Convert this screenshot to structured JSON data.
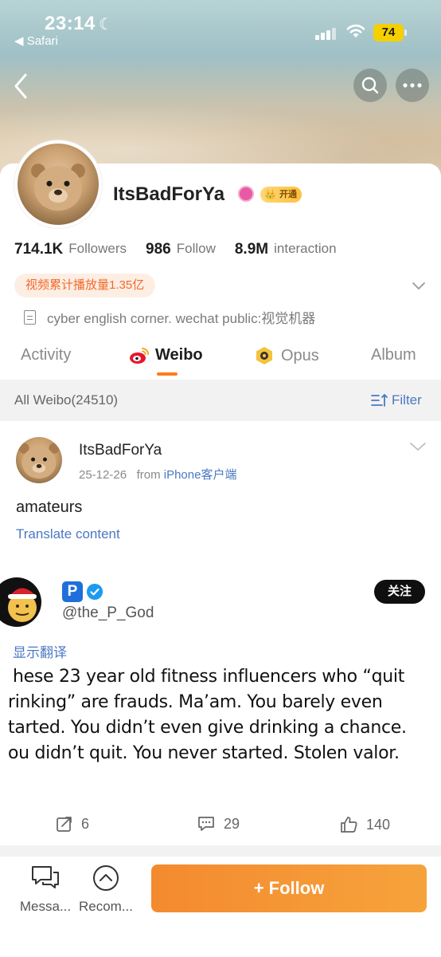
{
  "status_bar": {
    "time": "23:14",
    "back_app": "◀ Safari",
    "battery": "74"
  },
  "profile": {
    "username": "ItsBadForYa",
    "vip_badge": "开通",
    "stats": [
      {
        "value": "714.1K",
        "label": "Followers"
      },
      {
        "value": "986",
        "label": "Follow"
      },
      {
        "value": "8.9M",
        "label": "interaction"
      }
    ],
    "video_pill": "视频累计播放量1.35亿",
    "bio": "cyber english corner. wechat public:视觉机器"
  },
  "tabs": [
    {
      "label": "Activity"
    },
    {
      "label": "Weibo"
    },
    {
      "label": "Opus"
    },
    {
      "label": "Album"
    }
  ],
  "filter_bar": {
    "all_weibo": "All Weibo(24510)",
    "filter": "Filter"
  },
  "post": {
    "author": "ItsBadForYa",
    "date": "25-12-26",
    "from_prefix": "from",
    "source": "iPhone客户端",
    "text": "amateurs",
    "translate": "Translate content"
  },
  "embedded": {
    "badge_letter": "P",
    "handle": "@the_P_God",
    "follow": "关注",
    "translate": "显示翻译",
    "lines": [
      "hese 23 year old fitness influencers who “quit",
      "rinking” are frauds. Ma’am. You barely even",
      "tarted. You didn’t even give drinking a chance.",
      "ou didn’t quit. You never started. Stolen valor."
    ]
  },
  "actions": {
    "reposts": "6",
    "comments": "29",
    "likes": "140"
  },
  "bottom_bar": {
    "messages": "Messa...",
    "recommend": "Recom...",
    "follow": "+ Follow"
  },
  "colors": {
    "accent_orange": "#ff7b1a",
    "link_blue": "#4a78c3",
    "follow_gradient_start": "#f48a2f",
    "follow_gradient_end": "#f6a33c"
  }
}
